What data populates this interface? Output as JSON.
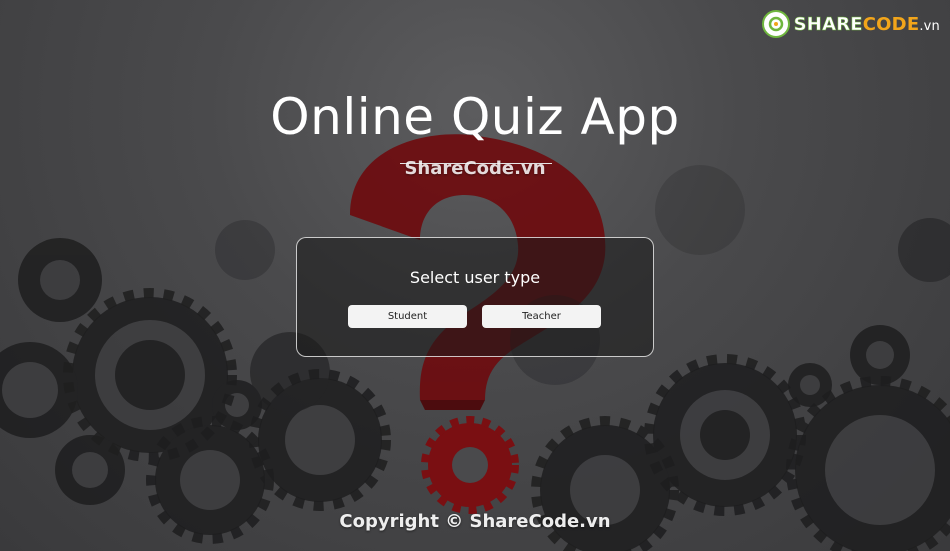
{
  "watermark": {
    "logo_share": "SHARE",
    "logo_code": "CODE",
    "logo_vn": ".vn",
    "center_text": "ShareCode.vn",
    "copyright": "Copyright © ShareCode.vn"
  },
  "page": {
    "title": "Online Quiz App"
  },
  "user_type_card": {
    "heading": "Select user type",
    "student_label": "Student",
    "teacher_label": "Teacher"
  },
  "colors": {
    "accent_red": "#7a0f12",
    "logo_green": "#6fb63e",
    "logo_orange": "#f2a51a"
  },
  "icons": {
    "logo": "sharecode-logo-icon",
    "background": "gears-question-mark-illustration"
  }
}
